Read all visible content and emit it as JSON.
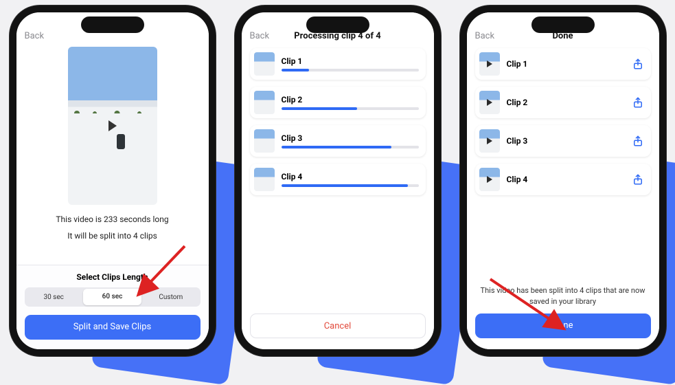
{
  "screen1": {
    "back": "Back",
    "info_line1": "This video is 233 seconds long",
    "info_line2": "It will be split into 4 clips",
    "sheet_title": "Select Clips Length",
    "seg": {
      "opt1": "30 sec",
      "opt2": "60 sec",
      "opt3": "Custom"
    },
    "primary": "Split and Save Clips"
  },
  "screen2": {
    "back": "Back",
    "title": "Processing clip 4 of 4",
    "clips": [
      {
        "name": "Clip 1",
        "progress": 20
      },
      {
        "name": "Clip 2",
        "progress": 55
      },
      {
        "name": "Clip 3",
        "progress": 80
      },
      {
        "name": "Clip 4",
        "progress": 92
      }
    ],
    "cancel": "Cancel"
  },
  "screen3": {
    "back": "Back",
    "title": "Done",
    "clips": [
      {
        "name": "Clip 1"
      },
      {
        "name": "Clip 2"
      },
      {
        "name": "Clip 3"
      },
      {
        "name": "Clip 4"
      }
    ],
    "message": "This video has been split into 4 clips that are now saved in your library",
    "done": "Done"
  }
}
